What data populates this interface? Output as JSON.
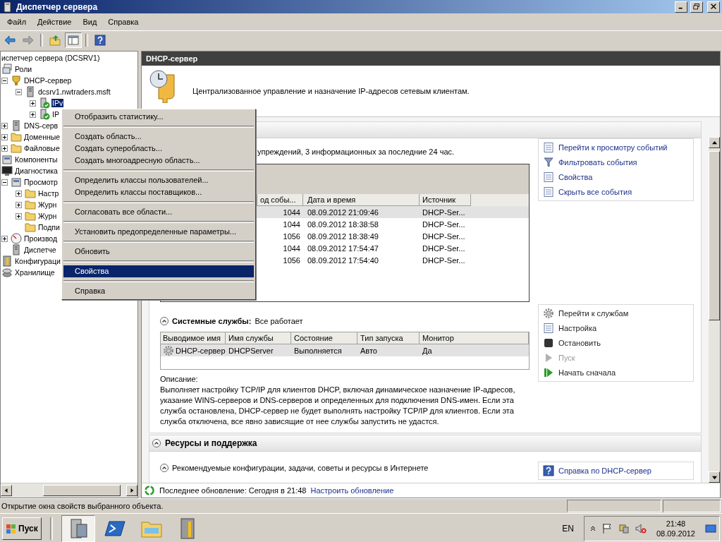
{
  "window": {
    "title": "Диспетчер сервера"
  },
  "menu_bar": [
    "Файл",
    "Действие",
    "Вид",
    "Справка"
  ],
  "toolbar": [
    {
      "kind": "back",
      "disabled": false,
      "selected": false
    },
    {
      "kind": "forward",
      "disabled": true,
      "selected": false
    },
    {
      "kind": "up",
      "disabled": false,
      "selected": false
    },
    {
      "kind": "pane",
      "disabled": false,
      "selected": true
    },
    {
      "kind": "help",
      "disabled": false,
      "selected": false
    }
  ],
  "tree": [
    {
      "label": "испетчер сервера (DCSRV1)",
      "selected": false,
      "children": [
        {
          "label": "Роли",
          "kind": "roles",
          "selected": false,
          "children": [
            {
              "label": "DHCP-сервер",
              "kind": "dhcp",
              "expanded": true,
              "selected": false,
              "children": [
                {
                  "label": "dcsrv1.nwtraders.msft",
                  "kind": "server",
                  "expanded": true,
                  "selected": false,
                  "children": [
                    {
                      "label": "IPv",
                      "kind": "scope",
                      "expanded": false,
                      "selected": true
                    },
                    {
                      "label": "IP",
                      "kind": "scope",
                      "expanded": false,
                      "selected": false
                    }
                  ]
                }
              ]
            },
            {
              "label": "DNS-серв",
              "kind": "dns",
              "expanded": false,
              "selected": false
            },
            {
              "label": "Доменные",
              "kind": "domain",
              "expanded": false,
              "selected": false
            },
            {
              "label": "Файловые",
              "kind": "files",
              "expanded": false,
              "selected": false
            }
          ]
        },
        {
          "label": "Компоненты",
          "kind": "features",
          "selected": false
        },
        {
          "label": "Диагностика",
          "kind": "diagnostics",
          "selected": false,
          "children": [
            {
              "label": "Просмотр",
              "kind": "events",
              "expanded": true,
              "selected": false,
              "children": [
                {
                  "label": "Настр",
                  "kind": "folder",
                  "expanded": false,
                  "selected": false
                },
                {
                  "label": "Журн",
                  "kind": "folder",
                  "expanded": false,
                  "selected": false
                },
                {
                  "label": "Журн",
                  "kind": "folder",
                  "expanded": false,
                  "selected": false
                },
                {
                  "label": "Подпи",
                  "kind": "folder",
                  "selected": false
                }
              ]
            },
            {
              "label": "Производ",
              "kind": "performance",
              "expanded": false,
              "selected": false
            },
            {
              "label": "Диспетче",
              "kind": "devices",
              "selected": false
            }
          ]
        },
        {
          "label": "Конфигураци",
          "kind": "config",
          "selected": false
        },
        {
          "label": "Хранилище",
          "kind": "storage",
          "selected": false
        }
      ]
    }
  ],
  "context_menu": {
    "groups": [
      {
        "items": [
          {
            "label": "Отобразить статистику...",
            "selected": false
          }
        ]
      },
      {
        "items": [
          {
            "label": "Создать область...",
            "selected": false
          },
          {
            "label": "Создать суперобласть...",
            "selected": false
          },
          {
            "label": "Создать многоадресную область...",
            "selected": false
          }
        ]
      },
      {
        "items": [
          {
            "label": "Определить классы пользователей...",
            "selected": false
          },
          {
            "label": "Определить классы поставщиков...",
            "selected": false
          }
        ]
      },
      {
        "items": [
          {
            "label": "Согласовать все области...",
            "selected": false
          }
        ]
      },
      {
        "items": [
          {
            "label": "Установить предопределенные параметры...",
            "selected": false
          }
        ]
      },
      {
        "items": [
          {
            "label": "Обновить",
            "selected": false
          }
        ]
      },
      {
        "items": [
          {
            "label": "Свойства",
            "selected": true
          }
        ]
      },
      {
        "items": [
          {
            "label": "Справка",
            "selected": false
          }
        ]
      }
    ]
  },
  "pane": {
    "title": "DHCP-сервер",
    "summary": "Централизованное управление и назначение IP-адресов сетевым клиентам."
  },
  "events": {
    "summary": "упреждений, 3 информационных за последние 24 час.",
    "columns": [
      "од собы...",
      "Дата и время",
      "Источник"
    ],
    "rows": [
      {
        "cells": [
          "1044",
          "08.09.2012 21:09:46",
          "DHCP-Ser..."
        ],
        "selected": true
      },
      {
        "cells": [
          "1044",
          "08.09.2012 18:38:58",
          "DHCP-Ser..."
        ],
        "selected": false
      },
      {
        "cells": [
          "1056",
          "08.09.2012 18:38:49",
          "DHCP-Ser..."
        ],
        "selected": false
      },
      {
        "cells": [
          "1044",
          "08.09.2012 17:54:47",
          "DHCP-Ser..."
        ],
        "selected": false
      },
      {
        "cells": [
          "1056",
          "08.09.2012 17:54:40",
          "DHCP-Ser..."
        ],
        "selected": false
      }
    ],
    "actions": [
      {
        "label": "Перейти к просмотру событий",
        "kind": "view-events",
        "disabled": false
      },
      {
        "label": "Фильтровать события",
        "kind": "filter",
        "disabled": false
      },
      {
        "label": "Свойства",
        "kind": "properties",
        "disabled": false
      },
      {
        "label": "Скрыть все события",
        "kind": "hide",
        "disabled": false
      }
    ]
  },
  "services": {
    "title": "Системные службы:",
    "status": "Все работает",
    "expanded": true,
    "columns": [
      "Выводимое имя",
      "Имя службы",
      "Состояние",
      "Тип запуска",
      "Монитор"
    ],
    "rows": [
      {
        "cells": [
          "DHCP-сервер",
          "DHCPServer",
          "Выполняется",
          "Авто",
          "Да"
        ],
        "selected": true
      }
    ],
    "description_label": "Описание:",
    "description": "Выполняет настройку TCP/IP для клиентов DHCP, включая динамическое назначение IP-адресов, указание WINS-серверов и DNS-серверов и определенных для подключения DNS-имен. Если эта служба остановлена, DHCP-сервер не будет выполнять настройку TCP/IP для клиентов. Если эта служба отключена, все явно зависящие от нее службы запустить не удастся.",
    "actions": [
      {
        "label": "Перейти к службам",
        "kind": "services",
        "disabled": false
      },
      {
        "label": "Настройка",
        "kind": "settings",
        "disabled": false
      },
      {
        "label": "Остановить",
        "kind": "stop",
        "disabled": false
      },
      {
        "label": "Пуск",
        "kind": "start",
        "disabled": true
      },
      {
        "label": "Начать сначала",
        "kind": "restart",
        "disabled": false
      }
    ]
  },
  "resources": {
    "title": "Ресурсы и поддержка",
    "expanded": true,
    "subsection": {
      "title": "Рекомендуемые конфигурации, задачи, советы и ресурсы в Интернете",
      "expanded": true
    },
    "actions": [
      {
        "label": "Справка по DHCP-сервер",
        "kind": "help",
        "disabled": false
      }
    ]
  },
  "refresh": {
    "text": "Последнее обновление: Сегодня в 21:48",
    "link": "Настроить обновление"
  },
  "status_bar": {
    "text": "Открытие окна свойств выбранного объекта."
  },
  "taskbar": {
    "start": "Пуск",
    "apps": [
      {
        "kind": "server-manager",
        "selected": true
      },
      {
        "kind": "powershell",
        "selected": false
      },
      {
        "kind": "explorer",
        "selected": false
      },
      {
        "kind": "tools",
        "selected": false
      }
    ],
    "language": "EN",
    "time": "21:48",
    "date": "08.09.2012"
  }
}
